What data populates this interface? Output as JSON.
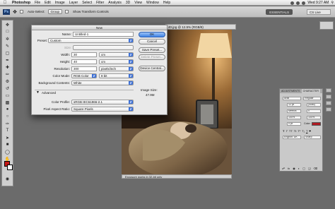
{
  "menubar": {
    "apple": "",
    "items": [
      "Photoshop",
      "File",
      "Edit",
      "Image",
      "Layer",
      "Select",
      "Filter",
      "Analysis",
      "3D",
      "View",
      "Window",
      "Help"
    ],
    "clock": "Wed 9:27 AM",
    "ps_badge": "Ps"
  },
  "options": {
    "auto_select_label": "Auto-Select:",
    "auto_select_value": "Group",
    "transform_label": "Show Transform Controls",
    "workspace": "ESSENTIALS",
    "cslive": "CS Live"
  },
  "document": {
    "title": "40.jpg @ 12.5% (RGB/8)",
    "status": "Exposure works in 32-bit only"
  },
  "dialog": {
    "title": "New",
    "name_label": "Name:",
    "name_value": "Untitled-1",
    "preset_label": "Preset:",
    "preset_value": "Custom",
    "size_label": "Size:",
    "width_label": "Width:",
    "width_value": "30",
    "width_unit": "cm",
    "height_label": "Height:",
    "height_value": "40",
    "height_unit": "cm",
    "resolution_label": "Resolution:",
    "resolution_value": "300",
    "resolution_unit": "pixels/inch",
    "color_mode_label": "Color Mode:",
    "color_mode_value": "RGB Color",
    "bit_depth": "8 bit",
    "bg_label": "Background Contents:",
    "bg_value": "White",
    "advanced_label": "Advanced",
    "profile_label": "Color Profile:",
    "profile_value": "sRGB IEC61966-2.1",
    "aspect_label": "Pixel Aspect Ratio:",
    "aspect_value": "Square Pixels",
    "image_size_label": "Image Size:",
    "image_size_value": "47.9M",
    "buttons": {
      "ok": "OK",
      "cancel": "Cancel",
      "save_preset": "Save Preset...",
      "delete_preset": "Delete Preset...",
      "device_central": "Device Central..."
    }
  },
  "panels": {
    "tabs": [
      "ADJUSTMENTS",
      "CHARACTER"
    ],
    "font_family": "Arial",
    "font_style": "Regular",
    "font_size": "12 pt",
    "leading": "(Auto)",
    "kerning": "Metrics",
    "tracking": "0",
    "scale_v": "100%",
    "scale_h": "100%",
    "baseline": "0 pt",
    "color_label": "Color:",
    "language": "English: UK",
    "aa": "Sharp",
    "accent_color": "#b01a22"
  },
  "colors": {
    "foreground": "#c21818",
    "background": "#ffffff"
  }
}
